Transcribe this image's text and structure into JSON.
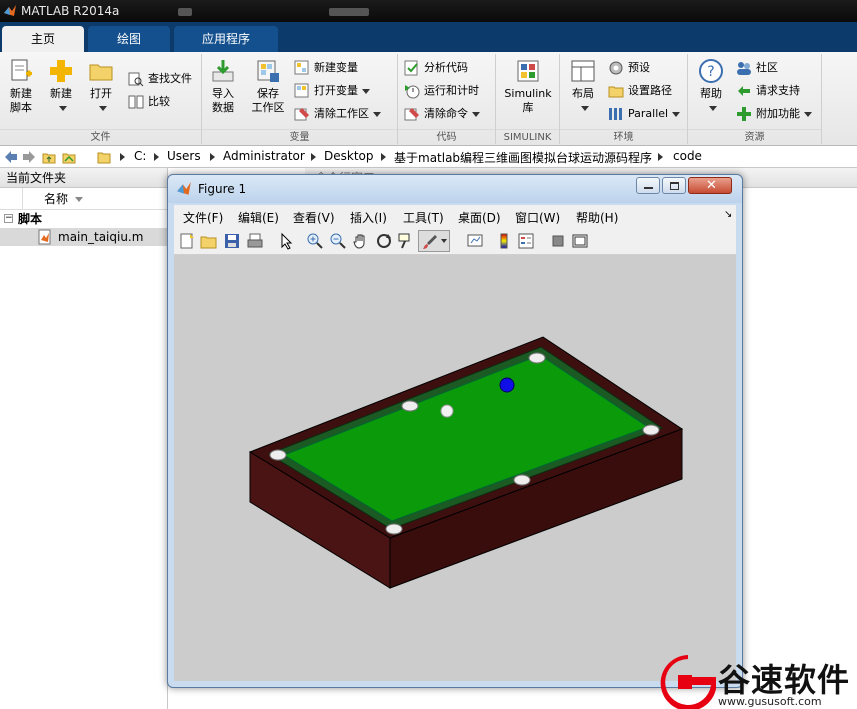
{
  "window": {
    "title": "MATLAB R2014a"
  },
  "tabs": [
    {
      "label": "主页",
      "active": true
    },
    {
      "label": "绘图",
      "active": false
    },
    {
      "label": "应用程序",
      "active": false
    }
  ],
  "ribbon": {
    "file": {
      "new_script": [
        "新建",
        "脚本"
      ],
      "new": "新建",
      "open": "打开",
      "find_files": "查找文件",
      "compare": "比较",
      "group_label": "文件"
    },
    "variable": {
      "import": [
        "导入",
        "数据"
      ],
      "save_ws": [
        "保存",
        "工作区"
      ],
      "new_var": "新建变量",
      "open_var": "打开变量",
      "clear_ws": "清除工作区",
      "group_label": "变量"
    },
    "code": {
      "analyze": "分析代码",
      "run_time": "运行和计时",
      "clear_cmd": "清除命令",
      "group_label": "代码"
    },
    "simulink": {
      "label": [
        "Simulink",
        "库"
      ],
      "group_label": "SIMULINK"
    },
    "env": {
      "layout": "布局",
      "prefs": "预设",
      "set_path": "设置路径",
      "parallel": "Parallel",
      "group_label": "环境"
    },
    "resources": {
      "help": "帮助",
      "community": "社区",
      "support": "请求支持",
      "addons": "附加功能",
      "group_label": "资源"
    }
  },
  "address": {
    "crumbs": [
      "C:",
      "Users",
      "Administrator",
      "Desktop",
      "基于matlab编程三维画图模拟台球运动源码程序",
      "code"
    ]
  },
  "left_panel": {
    "title": "当前文件夹",
    "col_name": "名称",
    "group": "脚本",
    "files": [
      "main_taiqiu.m"
    ]
  },
  "right_panel": {
    "title": "命令行窗口"
  },
  "figure": {
    "title": "Figure 1",
    "menus": [
      "文件(F)",
      "编辑(E)",
      "查看(V)",
      "插入(I)",
      "工具(T)",
      "桌面(D)",
      "窗口(W)",
      "帮助(H)"
    ]
  },
  "scene": {
    "table_felt": "#0a9a0a",
    "cushion": "#1c5a24",
    "wood": "#4a1414",
    "cue_ball_color": "#f2f2f2",
    "target_ball_color": "#1010e6"
  },
  "watermark": {
    "brand": "谷速软件",
    "url": "www.gususoft.com"
  }
}
